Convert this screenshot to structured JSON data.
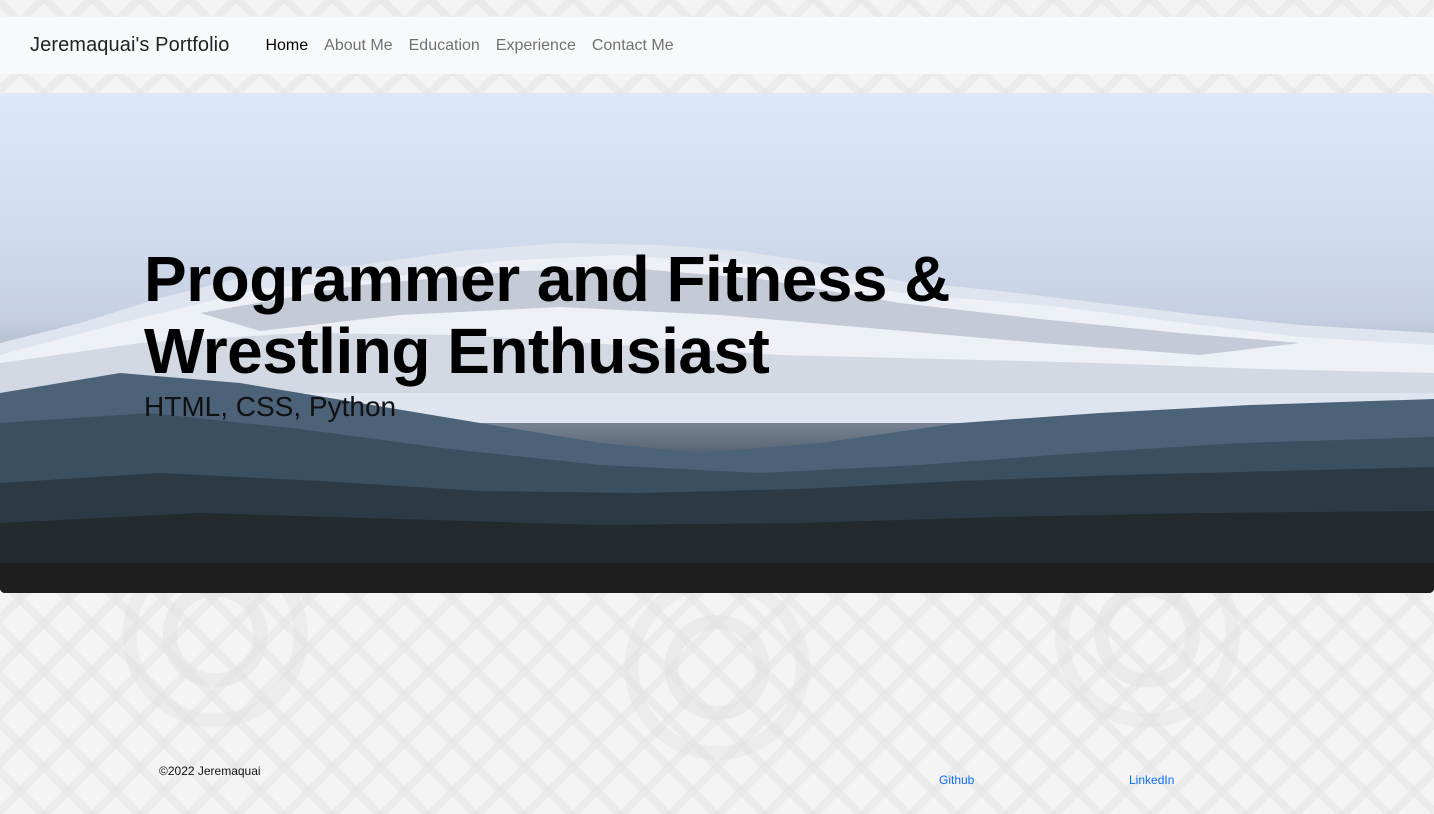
{
  "navbar": {
    "brand": "Jeremaquai's Portfolio",
    "links": [
      {
        "label": "Home",
        "active": true
      },
      {
        "label": "About Me",
        "active": false
      },
      {
        "label": "Education",
        "active": false
      },
      {
        "label": "Experience",
        "active": false
      },
      {
        "label": "Contact Me",
        "active": false
      }
    ]
  },
  "hero": {
    "title": "Programmer and Fitness & Wrestling Enthusiast",
    "subtitle": "HTML, CSS, Python"
  },
  "footer": {
    "copyright": "©2022 Jeremaquai",
    "links": [
      {
        "label": "Github"
      },
      {
        "label": "LinkedIn"
      }
    ]
  },
  "colors": {
    "navbar_bg": "#f8f9fa",
    "link_blue": "#0d6efd",
    "page_bg": "#f4f4f4"
  }
}
